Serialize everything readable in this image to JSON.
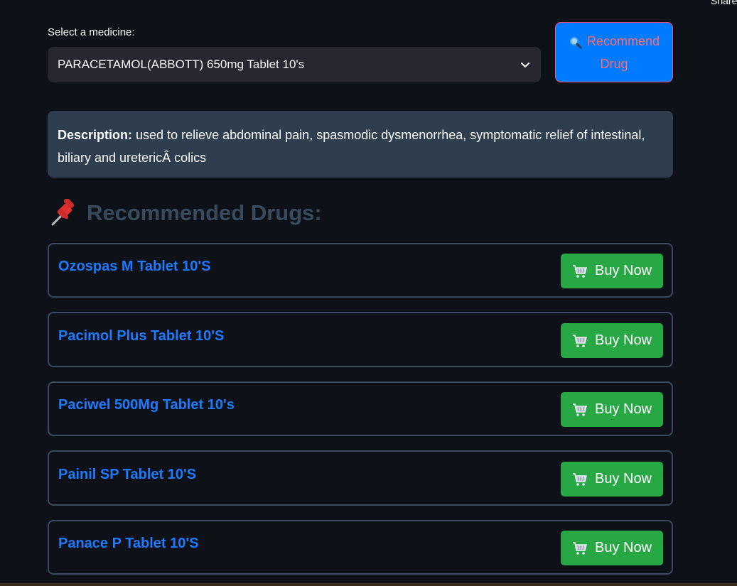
{
  "header": {
    "share_text": "Share"
  },
  "selector": {
    "label": "Select a medicine:",
    "selected_value": "PARACETAMOL(ABBOTT) 650mg Tablet 10's"
  },
  "recommend_button": {
    "line1": "Recommend",
    "line2": "Drug",
    "icon": "magnifier-icon"
  },
  "description": {
    "label": "Description:",
    "text": "used to relieve abdominal pain, spasmodic dysmenorrhea, symptomatic relief of intestinal, biliary and uretericÂ colics"
  },
  "recommended": {
    "heading": "Recommended Drugs:",
    "icon": "pin-icon",
    "buy_label": "Buy Now",
    "items": [
      {
        "name": "Ozospas M Tablet 10'S"
      },
      {
        "name": "Pacimol Plus Tablet 10'S"
      },
      {
        "name": "Paciwel 500Mg Tablet 10's"
      },
      {
        "name": "Painil SP Tablet 10'S"
      },
      {
        "name": "Panace P Tablet 10'S"
      }
    ]
  },
  "colors": {
    "background": "#0e1117",
    "accent_blue": "#007bff",
    "buy_green": "#28a745",
    "description_bg": "#2f3e4e"
  }
}
